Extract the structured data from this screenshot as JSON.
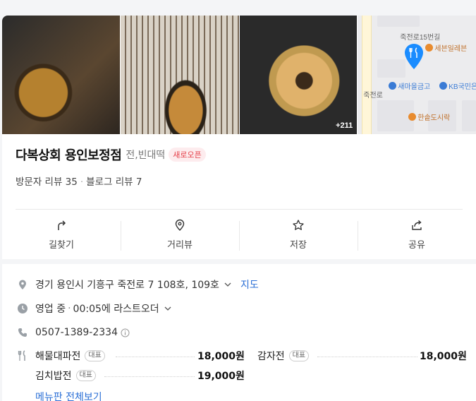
{
  "photos": {
    "more_count": "+211"
  },
  "map": {
    "street1": "죽전로15번길",
    "street2": "죽전로",
    "poi_seven": "세븐일레븐",
    "poi_bank": "새마을금고",
    "poi_kb": "KB국민은",
    "poi_hansot": "한솥도시락"
  },
  "place": {
    "name": "다복상회 용인보정점",
    "category": "전,빈대떡",
    "badge": "새로오픈",
    "visitor_reviews": "방문자 리뷰 35",
    "blog_reviews": "블로그 리뷰 7"
  },
  "actions": [
    {
      "label": "길찾기",
      "icon": "directions-icon"
    },
    {
      "label": "거리뷰",
      "icon": "streetview-icon"
    },
    {
      "label": "저장",
      "icon": "star-icon"
    },
    {
      "label": "공유",
      "icon": "share-icon"
    }
  ],
  "info": {
    "address": "경기 용인시 기흥구 죽전로 7 108호, 109호",
    "map_link": "지도",
    "status": "영업 중",
    "last_order": "00:05에 라스트오더",
    "phone": "0507-1389-2334"
  },
  "menu": {
    "items": [
      {
        "name": "해물대파전",
        "tag": "대표",
        "price": "18,000원"
      },
      {
        "name": "감자전",
        "tag": "대표",
        "price": "18,000원"
      },
      {
        "name": "김치밥전",
        "tag": "대표",
        "price": "19,000원"
      }
    ],
    "view_all": "메뉴판 전체보기"
  },
  "colors": {
    "link": "#2b6fd6",
    "badge": "#e5404a",
    "pin": "#1a8cff"
  }
}
